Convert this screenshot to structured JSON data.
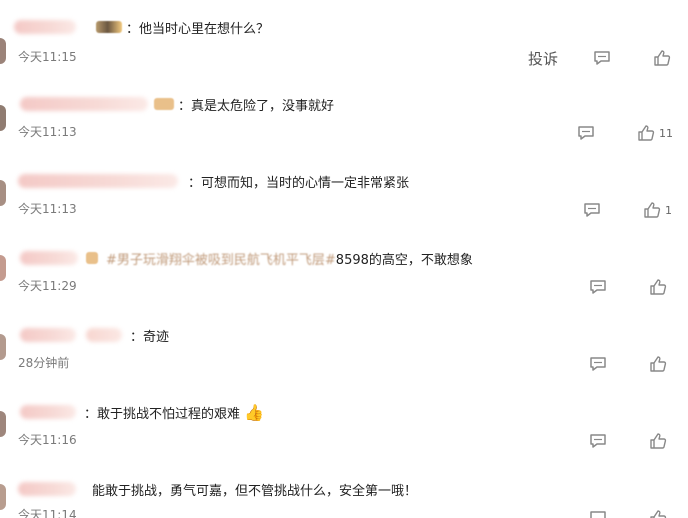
{
  "comments": [
    {
      "text": "：他当时心里在想什么？",
      "time": "今天11:15",
      "report_label": "投诉",
      "like_count": ""
    },
    {
      "text": "：真是太危险了，没事就好",
      "time": "今天11:13",
      "like_count": "11"
    },
    {
      "text": "：可想而知，当时的心情一定非常紧张",
      "time": "今天11:13",
      "like_count": "1"
    },
    {
      "topic": "#男子玩滑翔伞被吸到民航飞机平飞层#",
      "text": "8598的高空，不敢想象",
      "time": "今天11:29",
      "like_count": ""
    },
    {
      "text": "：奇迹",
      "time": "28分钟前",
      "like_count": ""
    },
    {
      "text": "：敢于挑战不怕过程的艰难",
      "emoji": "👍",
      "time": "今天11:16",
      "like_count": ""
    },
    {
      "text": "能敢于挑战，勇气可嘉，但不管挑战什么，安全第一哦！",
      "time": "今天11:14",
      "like_count": ""
    }
  ],
  "icons": {
    "reply": "comment-bubble-icon",
    "like": "thumbs-up-icon"
  },
  "colors": {
    "username_blur": "#f4c9c6",
    "time": "#7a7a7a",
    "text": "#222222",
    "icon": "#888888"
  }
}
